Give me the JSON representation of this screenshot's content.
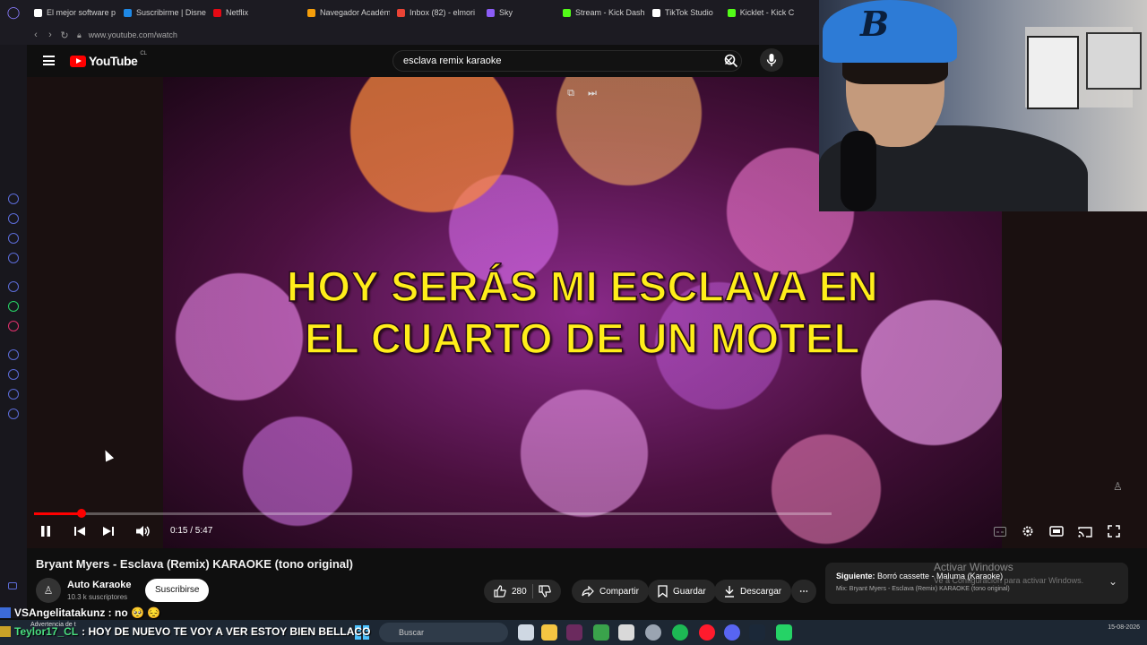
{
  "browser": {
    "tabs": [
      {
        "label": "El mejor software p",
        "color": "#ffffff"
      },
      {
        "label": "Suscribirme | Disne",
        "color": "#1e88e5"
      },
      {
        "label": "Netflix",
        "color": "#e50914"
      },
      {
        "label": "Navegador Académ",
        "color": "#f59e0b"
      },
      {
        "label": "Inbox (82) - elmori",
        "color": "#ea4335"
      },
      {
        "label": "Sky",
        "color": "#8b5cf6"
      },
      {
        "label": "Stream - Kick Dash",
        "color": "#53fc18"
      },
      {
        "label": "TikTok Studio",
        "color": "#ffffff"
      },
      {
        "label": "Kicklet - Kick C",
        "color": "#53fc18"
      }
    ],
    "url": "www.youtube.com/watch"
  },
  "youtube": {
    "logo_text": "YouTube",
    "country_code": "CL",
    "search_query": "esclava remix karaoke"
  },
  "player": {
    "lyric_line1": "HOY SERÁS MI ESCLAVA EN",
    "lyric_line2": "EL CUARTO DE UN MOTEL",
    "time_display": "0:15 / 5:47",
    "progress_fraction": 0.06,
    "state": "playing"
  },
  "video": {
    "title": "Bryant Myers - Esclava (Remix) KARAOKE (tono original)",
    "channel": "Auto Karaoke",
    "subscribers": "10.3 k suscriptores",
    "subscribe_label": "Suscribirse",
    "likes": "280",
    "share_label": "Compartir",
    "save_label": "Guardar",
    "download_label": "Descargar"
  },
  "up_next": {
    "prefix": "Siguiente:",
    "title": "Borró cassette - Maluma (Karaoke)",
    "playlist": "Mix: Bryant Myers - Esclava (Remix) KARAOKE (tono original)"
  },
  "windows_watermark": {
    "line1": "Activar Windows",
    "line2": "Ve a Configuración para activar Windows."
  },
  "chat": {
    "message1": "VSAngelitatakunz : no 🥺 😔",
    "small_note": "Advertencia de t",
    "user2": "Teylor17_CL",
    "message2": ": HOY DE NUEVO TE VOY A VER ESTOY BIEN BELLACO"
  },
  "taskbar": {
    "search_placeholder": "Buscar",
    "date": "15-08-2026"
  },
  "colors": {
    "accent_red": "#ff0000",
    "lyric_yellow": "#ffee1a"
  }
}
